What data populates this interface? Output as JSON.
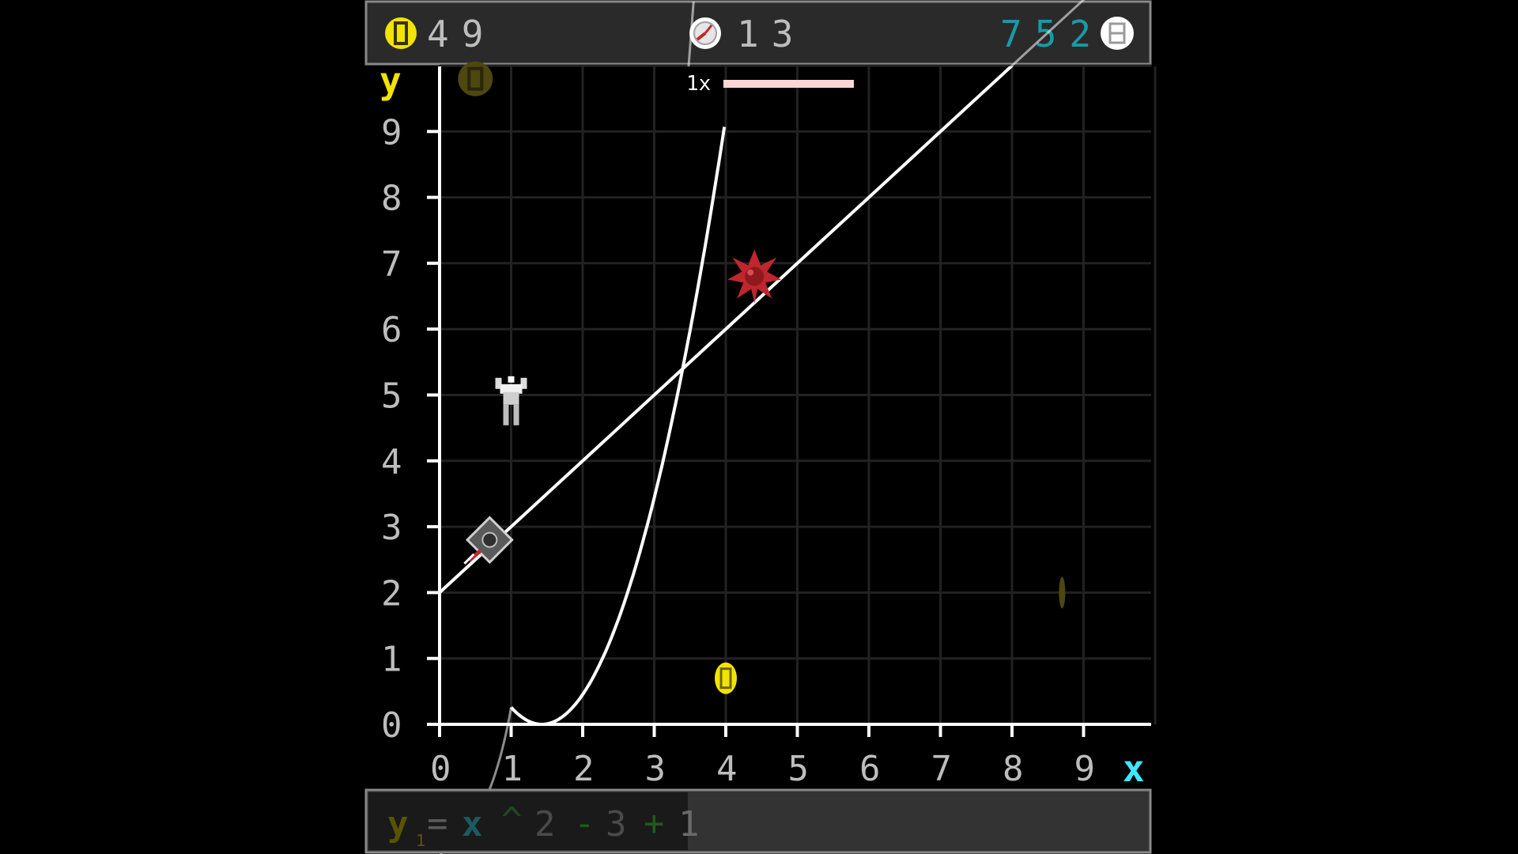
{
  "hud": {
    "coins": "49",
    "timer": "13",
    "score": "752",
    "speed": "1x",
    "speed_progress": 1.0
  },
  "axes": {
    "y_label": "y",
    "x_label": "x",
    "x_ticks": [
      "0",
      "1",
      "2",
      "3",
      "4",
      "5",
      "6",
      "7",
      "8",
      "9"
    ],
    "y_ticks": [
      "0",
      "1",
      "2",
      "3",
      "4",
      "5",
      "6",
      "7",
      "8",
      "9"
    ]
  },
  "graph": {
    "line": {
      "slope": 1,
      "intercept": 2
    },
    "curve": {
      "equation": "y = x^2 - 3 + 1"
    }
  },
  "entities": {
    "player": {
      "x": 0.7,
      "y": 2.8
    },
    "enemy_explosion": {
      "x": 4.4,
      "y": 6.8
    },
    "robot": {
      "x": 1.0,
      "y": 4.9
    },
    "coin_active": {
      "x": 4.0,
      "y": 0.7
    },
    "coin_faded": {
      "x": 0.5,
      "y": 9.8
    },
    "coin_edge": {
      "x": 8.7,
      "y": 2.0
    }
  },
  "equation_bar": {
    "y_label": "y",
    "subscript": "1",
    "equals": "=",
    "x": "x",
    "power": "^",
    "exponent": "2",
    "minus": "-",
    "three": "3",
    "plus": "+",
    "one": "1"
  },
  "colors": {
    "coin": "#f2e300",
    "score": "#1a9aa6",
    "y_axis_label": "#f2e300",
    "x_axis_label": "#3fe6ff",
    "enemy": "#c0262d"
  }
}
